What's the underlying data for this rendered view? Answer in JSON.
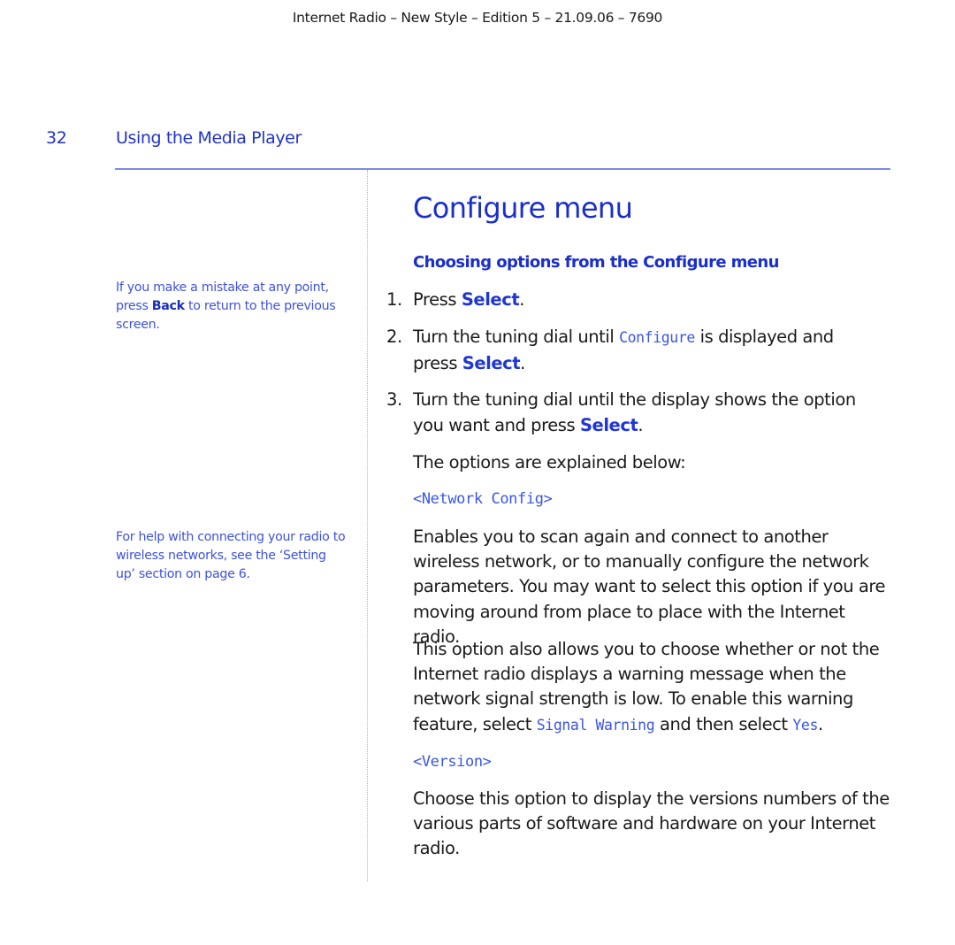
{
  "header": {
    "text": "Internet Radio – New Style – Edition 5 – 21.09.06 – 7690"
  },
  "section": {
    "page_number": "32",
    "title": "Using the Media Player"
  },
  "sidenotes": {
    "mistake": {
      "before": "If you make a mistake at any point, press ",
      "key": "Back",
      "after": " to return to the previous screen."
    },
    "help": {
      "text": "For help with connecting your radio to wireless networks, see the ‘Setting up’ section on page 6."
    }
  },
  "main": {
    "title": "Configure menu",
    "subheading": "Choosing options from the Configure menu",
    "steps": [
      {
        "num": "1.",
        "before": "Press ",
        "key": "Select",
        "after": "."
      },
      {
        "num": "2.",
        "before": "Turn the tuning dial until ",
        "lcd": "Configure",
        "middle": " is displayed and press ",
        "key": "Select",
        "after": "."
      },
      {
        "num": "3.",
        "before": "Turn the tuning dial until the display shows the option you want and press ",
        "key": "Select",
        "after": "."
      }
    ],
    "options_intro": "The options are explained below:",
    "options": [
      {
        "label": "<Network Config>",
        "paragraphs": [
          {
            "text": "Enables you to scan again and connect to another wireless network, or to manually configure the network parameters. You may want to select this option if you are moving around from place to place with the Internet radio."
          },
          {
            "before": "This option also allows you to choose whether or not the Internet radio displays a warning message when the network signal strength is low. To enable this warning feature, select ",
            "lcd1": "Signal Warning",
            "middle": " and then select ",
            "lcd2": "Yes",
            "after": "."
          }
        ]
      },
      {
        "label": "<Version>",
        "paragraphs": [
          {
            "text": "Choose this option to display the versions numbers of the various parts of software and hardware on your Internet radio."
          }
        ]
      }
    ]
  },
  "colors": {
    "accent_blue": "#1a2ecc",
    "lcd_blue": "#3a55e8",
    "rule_blue": "#7c8ae6",
    "body_text": "#1a1a1a"
  }
}
